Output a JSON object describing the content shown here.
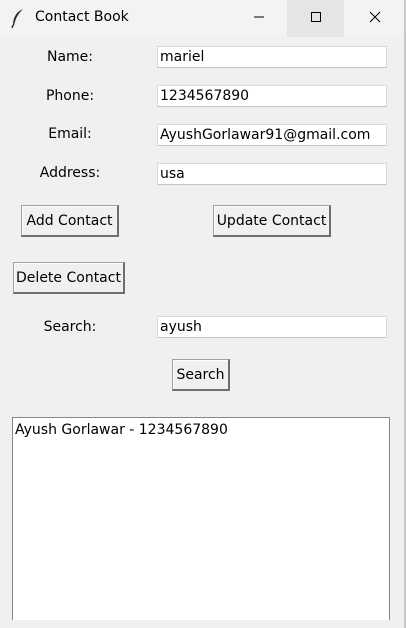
{
  "window": {
    "title": "Contact Book",
    "icon": "feather-icon",
    "controls": {
      "minimize_icon": "minimize-icon",
      "maximize_icon": "maximize-icon",
      "close_icon": "close-icon"
    }
  },
  "form": {
    "name_label": "Name:",
    "name_value": "mariel",
    "phone_label": "Phone:",
    "phone_value": "1234567890",
    "email_label": "Email:",
    "email_value": "AyushGorlawar91@gmail.com",
    "address_label": "Address:",
    "address_value": "usa"
  },
  "actions": {
    "add_label": "Add Contact",
    "update_label": "Update Contact",
    "delete_label": "Delete Contact"
  },
  "search": {
    "label": "Search:",
    "value": "ayush",
    "button_label": "Search"
  },
  "results": {
    "items": [
      "Ayush Gorlawar - 1234567890"
    ]
  },
  "colors": {
    "window_bg": "#f0f0f0",
    "titlebar_bg": "#f3f3f3",
    "maximize_hover_bg": "#e5e5e5",
    "entry_bg": "#ffffff"
  }
}
